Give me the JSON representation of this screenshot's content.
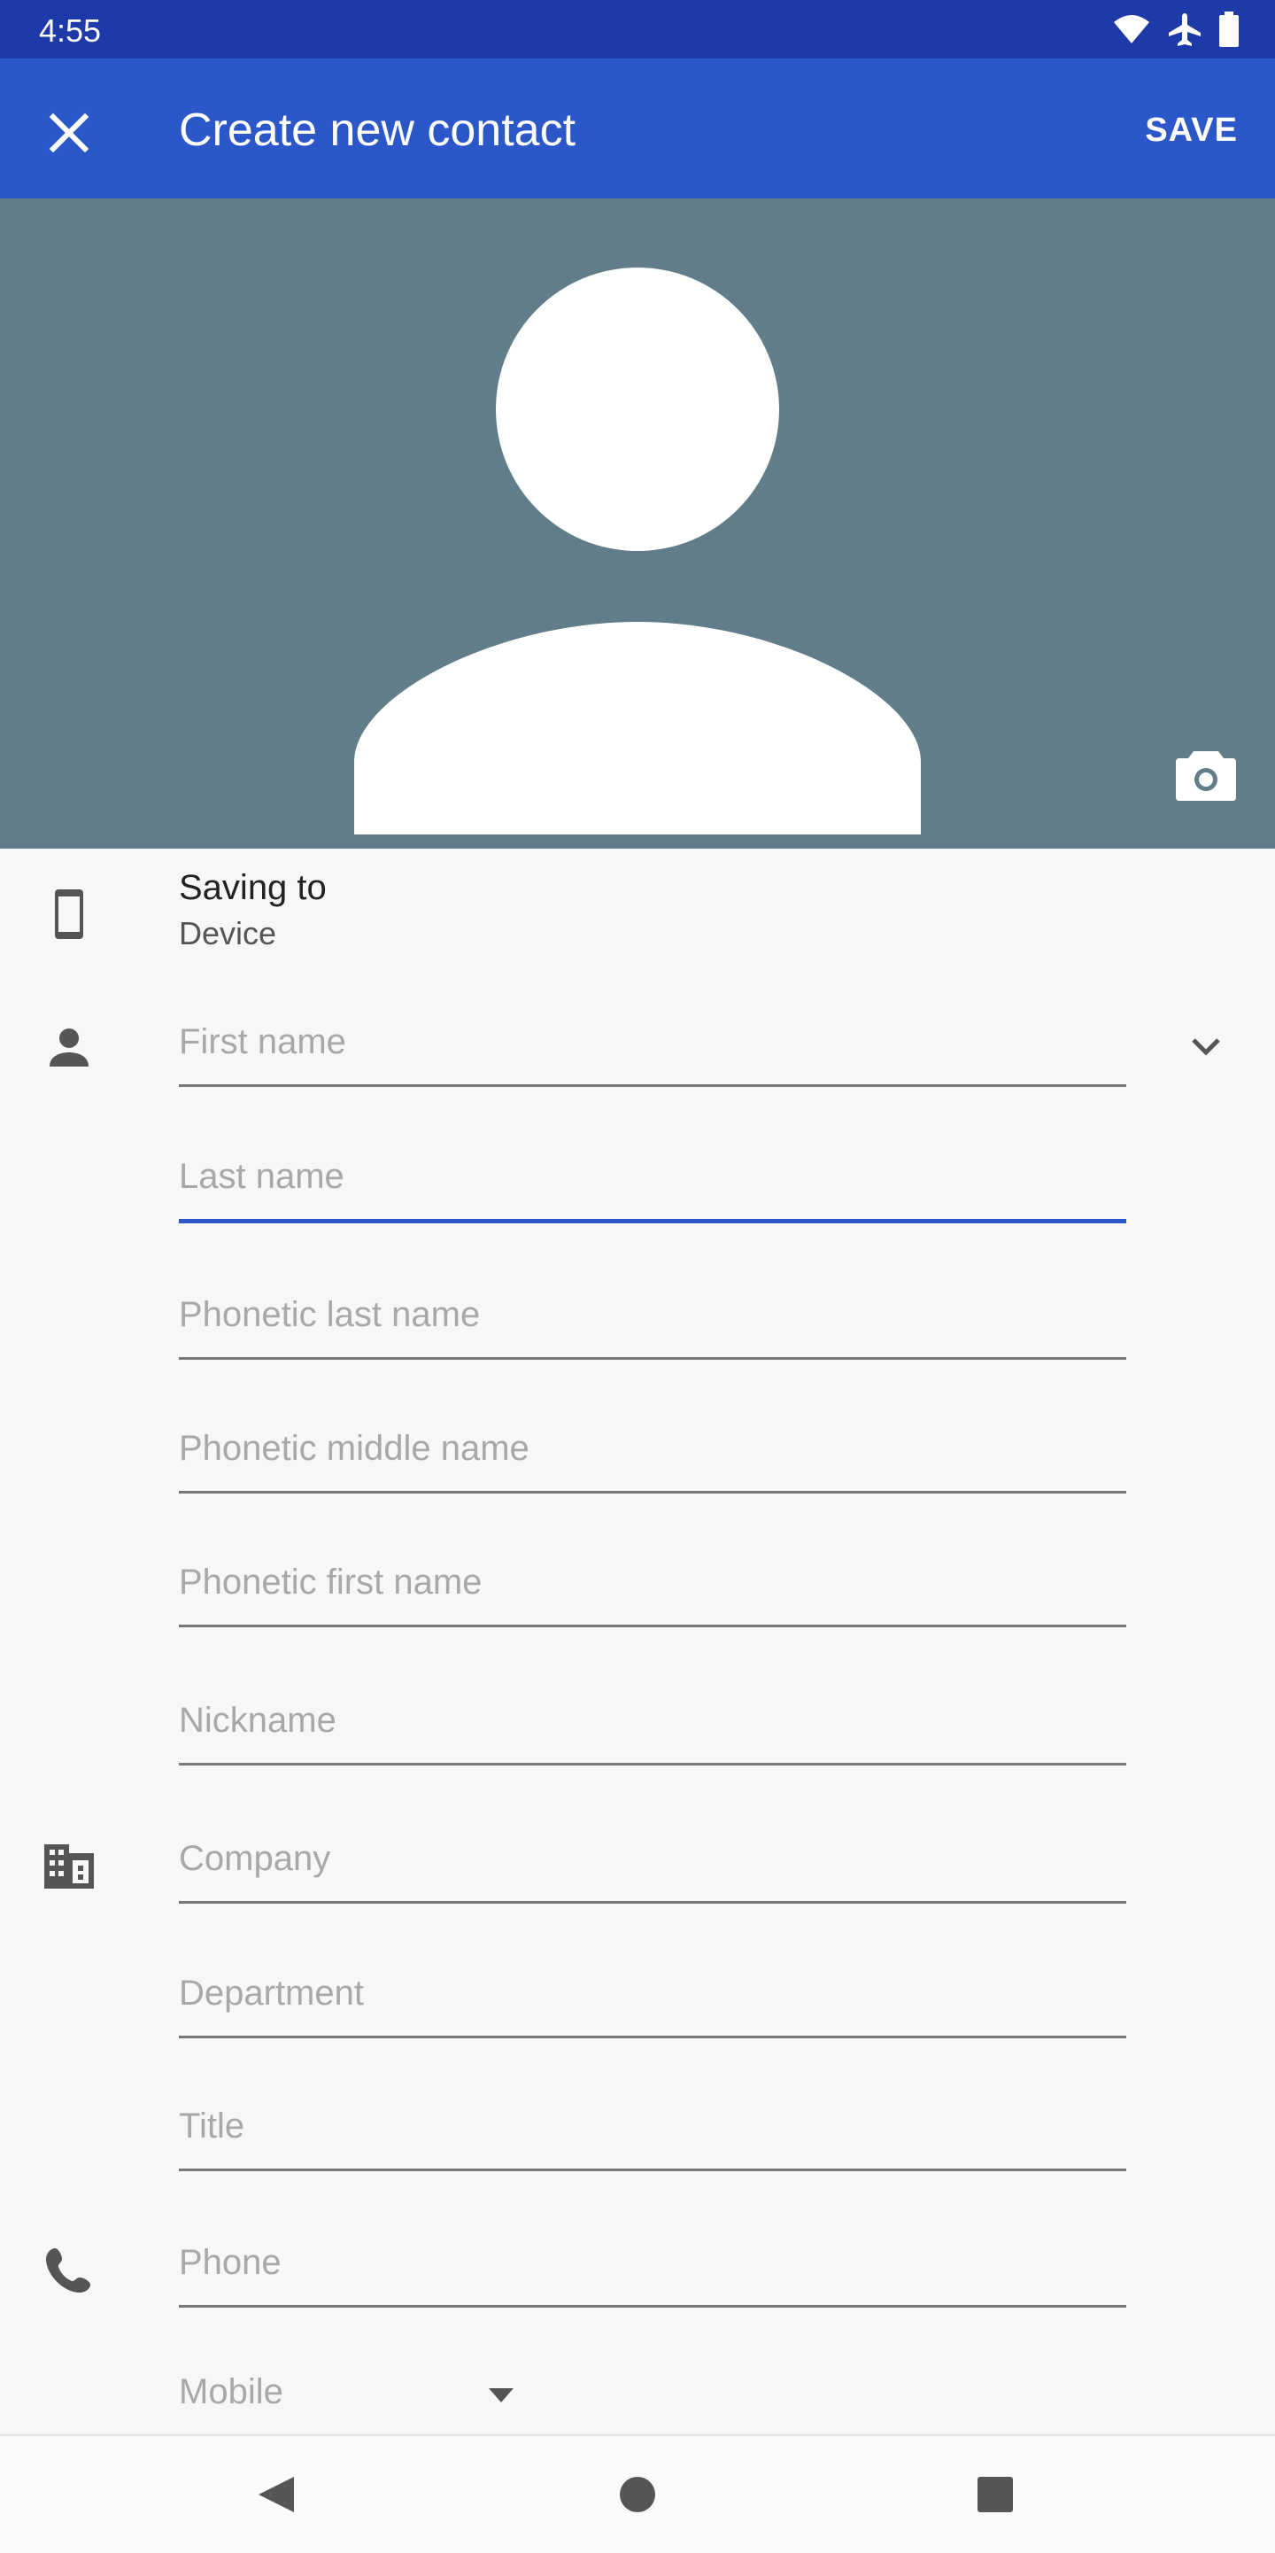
{
  "status_bar": {
    "time": "4:55",
    "icons": [
      "wifi-icon",
      "airplane-icon",
      "battery-icon"
    ]
  },
  "app_bar": {
    "title": "Create new contact",
    "save_label": "SAVE",
    "close_icon": "close-icon"
  },
  "photo": {
    "avatar_icon": "person-silhouette-icon",
    "camera_icon": "camera-icon"
  },
  "account": {
    "label": "Saving to",
    "value": "Device",
    "icon": "phone-device-icon"
  },
  "fields": {
    "first_name": "First name",
    "last_name": "Last name",
    "phonetic_last_name": "Phonetic last name",
    "phonetic_middle_name": "Phonetic middle name",
    "phonetic_first_name": "Phonetic first name",
    "nickname": "Nickname",
    "company": "Company",
    "department": "Department",
    "title": "Title",
    "phone": "Phone",
    "phone_type": "Mobile"
  },
  "colors": {
    "status_bar": "#1e3aa8",
    "app_bar": "#2b57c9",
    "photo_background": "#617d8a",
    "focus_underline": "#2b57c9"
  },
  "nav": [
    "back-icon",
    "home-icon",
    "recents-icon"
  ]
}
